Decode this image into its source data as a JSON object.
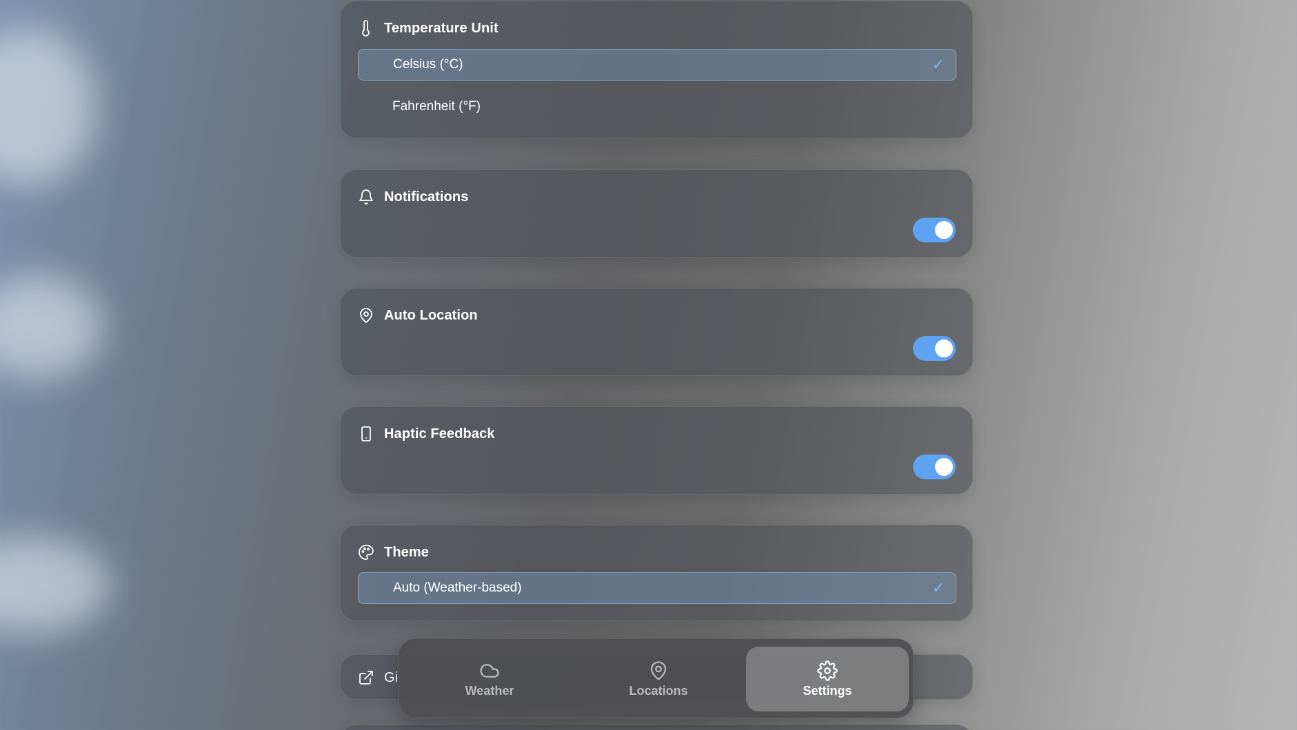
{
  "settings": {
    "temperature": {
      "title": "Temperature Unit",
      "icon": "thermometer-icon",
      "options": [
        {
          "label": "Celsius (°C)",
          "selected": true
        },
        {
          "label": "Fahrenheit (°F)",
          "selected": false
        }
      ],
      "check": "✓"
    },
    "notifications": {
      "title": "Notifications",
      "icon": "bell-icon",
      "enabled": true
    },
    "auto_location": {
      "title": "Auto Location",
      "icon": "map-pin-icon",
      "enabled": true
    },
    "haptic": {
      "title": "Haptic Feedback",
      "icon": "phone-icon",
      "enabled": true
    },
    "theme": {
      "title": "Theme",
      "icon": "palette-icon",
      "selected": "Auto (Weather-based)",
      "check": "✓"
    },
    "github": {
      "title_partial": "Gi",
      "icon": "external-link-icon"
    }
  },
  "tabbar": {
    "tabs": [
      {
        "label": "Weather",
        "icon": "cloud-icon",
        "active": false
      },
      {
        "label": "Locations",
        "icon": "map-pin-icon",
        "active": false
      },
      {
        "label": "Settings",
        "icon": "gear-icon",
        "active": true
      }
    ]
  },
  "colors": {
    "accent": "#5ea2f2",
    "check": "#7fb3f0"
  }
}
